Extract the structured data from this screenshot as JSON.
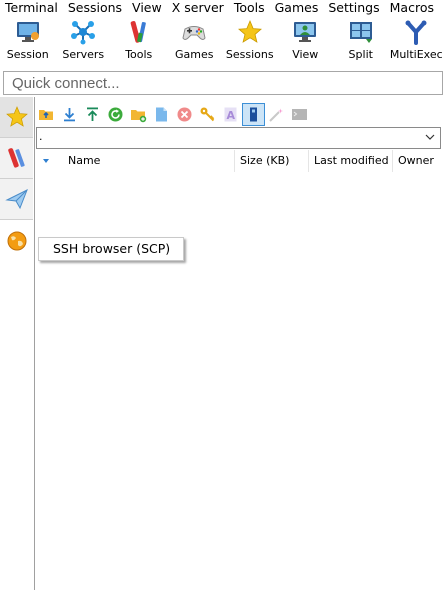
{
  "menu": [
    "Terminal",
    "Sessions",
    "View",
    "X server",
    "Tools",
    "Games",
    "Settings",
    "Macros"
  ],
  "toolbar": [
    {
      "label": "Session",
      "icon": "session-icon"
    },
    {
      "label": "Servers",
      "icon": "servers-icon"
    },
    {
      "label": "Tools",
      "icon": "tools-icon"
    },
    {
      "label": "Games",
      "icon": "games-icon"
    },
    {
      "label": "Sessions",
      "icon": "star-icon"
    },
    {
      "label": "View",
      "icon": "view-icon"
    },
    {
      "label": "Split",
      "icon": "split-icon"
    },
    {
      "label": "MultiExec",
      "icon": "multiexec-icon"
    }
  ],
  "quick_connect": {
    "placeholder": "Quick connect..."
  },
  "side_tabs": [
    {
      "name": "favorites",
      "icon": "star-icon"
    },
    {
      "name": "tools",
      "icon": "tools-icon"
    },
    {
      "name": "send",
      "icon": "paper-plane-icon"
    },
    {
      "name": "ssh-browser",
      "icon": "globe-icon"
    }
  ],
  "browser_toolbar": [
    "upload-folder-icon",
    "download-icon",
    "upload-icon",
    "refresh-icon",
    "new-folder-icon",
    "new-file-icon",
    "delete-icon",
    "key-icon",
    "rename-icon",
    "hidden-files-icon",
    "wand-icon",
    "terminal-icon"
  ],
  "path": {
    "value": "."
  },
  "columns": {
    "name": "Name",
    "size": "Size (KB)",
    "modified": "Last modified",
    "owner": "Owner"
  },
  "tooltip": {
    "text": "SSH browser (SCP)"
  },
  "colors": {
    "accent": "#3c8fd6",
    "star": "#f5c518",
    "sidebar_bg": "#f2f2f2"
  }
}
